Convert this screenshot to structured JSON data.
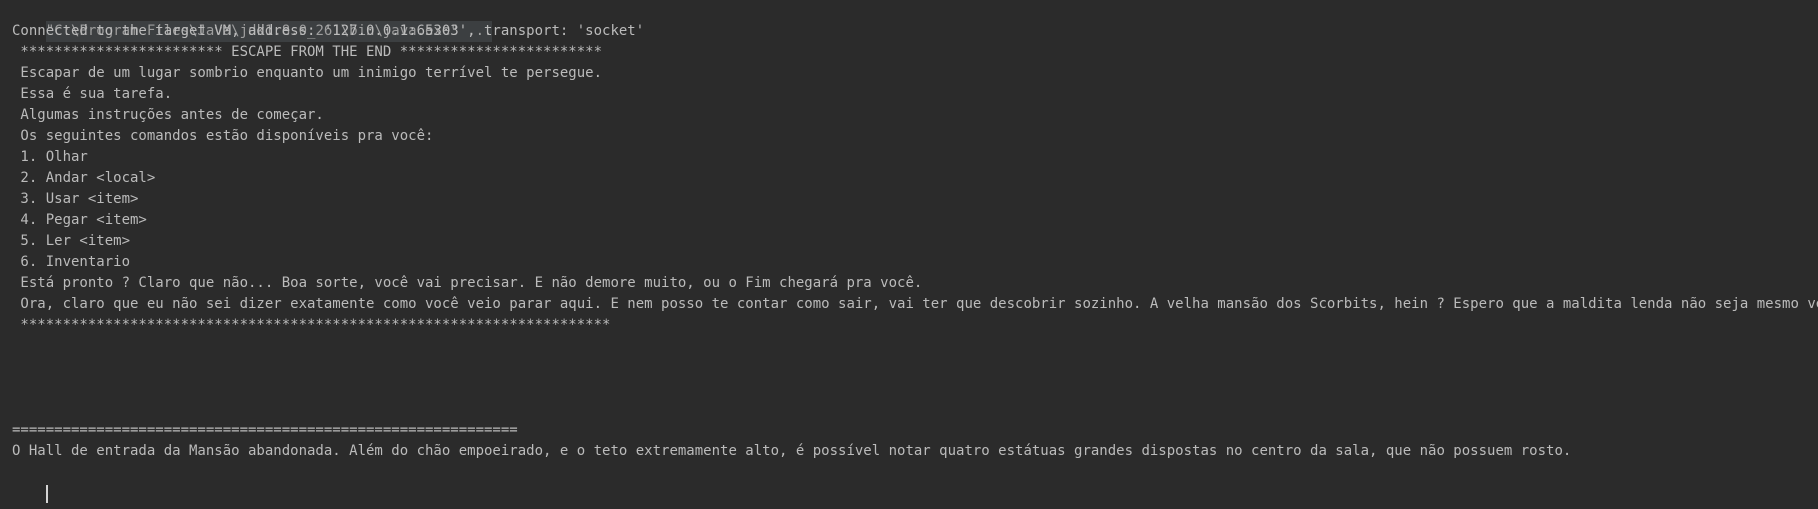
{
  "console": {
    "command_line": "\"C:\\Program Files\\Java\\jdk1.8.0_261\\bin\\java.exe\" ...",
    "lines": [
      "Connected to the target VM, address: '127.0.0.1:65303', transport: 'socket'",
      " ************************ ESCAPE FROM THE END ************************",
      " Escapar de um lugar sombrio enquanto um inimigo terrível te persegue.",
      " Essa é sua tarefa.",
      " Algumas instruções antes de começar.",
      " Os seguintes comandos estão disponíveis pra você:",
      " 1. Olhar",
      " 2. Andar <local>",
      " 3. Usar <item>",
      " 4. Pegar <item>",
      " 5. Ler <item>",
      " 6. Inventario",
      " Está pronto ? Claro que não... Boa sorte, você vai precisar. E não demore muito, ou o Fim chegará pra você.",
      " Ora, claro que eu não sei dizer exatamente como você veio parar aqui. E nem posso te contar como sair, vai ter que descobrir sozinho. A velha mansão dos Scorbits, hein ? Espero que a maldita lenda não seja mesmo verdadeira.",
      " **********************************************************************",
      "",
      "",
      "",
      "",
      "============================================================",
      "O Hall de entrada da Mansão abandonada. Além do chão empoeirado, e o teto extremamente alto, é possível notar quatro estátuas grandes dispostas no centro da sala, que não possuem rosto."
    ]
  }
}
